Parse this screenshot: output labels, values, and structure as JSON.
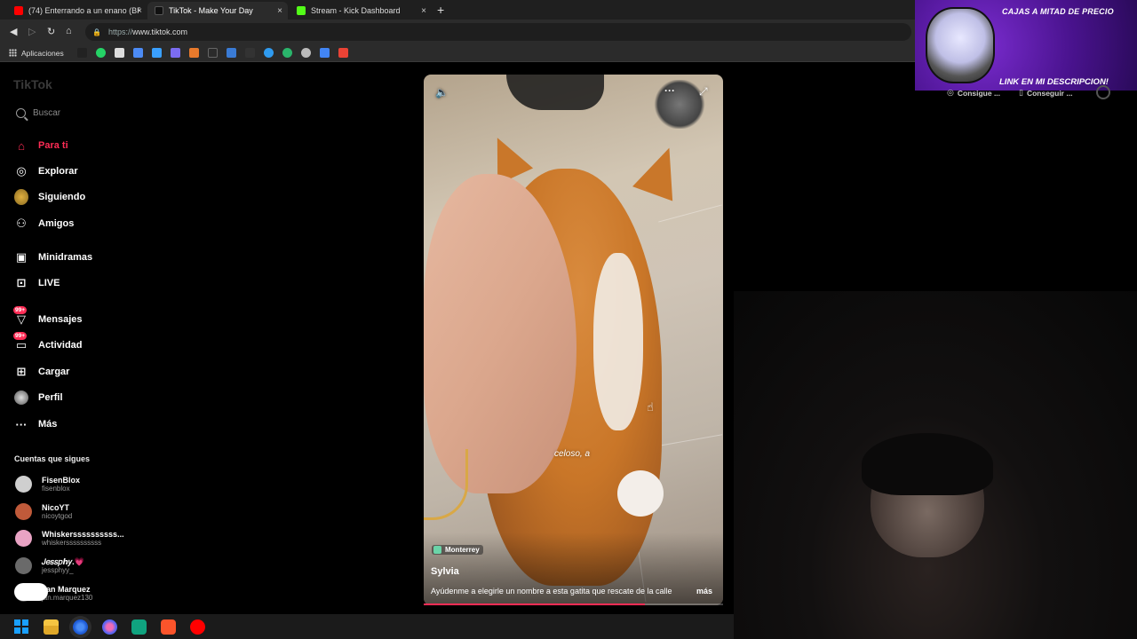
{
  "browser": {
    "tabs": [
      {
        "title": "(74) Enterrando a un enano (BR",
        "favicon_color": "#ff0000",
        "close": "×"
      },
      {
        "title": "TikTok - Make Your Day",
        "favicon_color": "#111111",
        "close": "×"
      },
      {
        "title": "Stream - Kick Dashboard",
        "favicon_color": "#53fc18",
        "close": "×"
      }
    ],
    "new_tab": "+",
    "url_scheme": "https://",
    "url_host": "www.tiktok.com",
    "bookmarks_apps_label": "Aplicaciones"
  },
  "sidebar": {
    "logo": "TikTok",
    "search_placeholder": "Buscar",
    "items": [
      {
        "label": "Para ti",
        "icon": "home-icon",
        "glyph": "⌂"
      },
      {
        "label": "Explorar",
        "icon": "compass-icon",
        "glyph": "◎"
      },
      {
        "label": "Siguiendo",
        "icon": "following-avatar-icon",
        "glyph": ""
      },
      {
        "label": "Amigos",
        "icon": "friends-icon",
        "glyph": "👥"
      },
      {
        "label": "Minidramas",
        "icon": "minidrama-icon",
        "glyph": "▣"
      },
      {
        "label": "LIVE",
        "icon": "live-icon",
        "glyph": "📺"
      },
      {
        "label": "Mensajes",
        "icon": "messages-icon",
        "glyph": "▽",
        "badge": "99+"
      },
      {
        "label": "Actividad",
        "icon": "activity-icon",
        "glyph": "▭",
        "badge": "99+"
      },
      {
        "label": "Cargar",
        "icon": "upload-icon",
        "glyph": "⊞"
      },
      {
        "label": "Perfil",
        "icon": "profile-avatar-icon",
        "glyph": ""
      },
      {
        "label": "Más",
        "icon": "more-dots-icon",
        "glyph": "···"
      }
    ],
    "following_title": "Cuentas que sigues",
    "following": [
      {
        "name": "FisenBlox",
        "username": "fisenblox",
        "avatar_color": "#cfcfcf"
      },
      {
        "name": "NicoYT",
        "username": "nicoytgod",
        "avatar_color": "#c05a3a"
      },
      {
        "name": "Whiskerssssssssss...",
        "username": "whiskerssssssssss",
        "avatar_color": "#e9a3c4"
      },
      {
        "name": "𝐽𝑒𝑠𝑠𝑝ℎ𝑦.💗",
        "username": "jessphyy_",
        "avatar_color": "#6a6a6a"
      },
      {
        "name": "Jan Marquez",
        "username": "jan.marquez130",
        "avatar_color": "#444444"
      }
    ]
  },
  "video": {
    "caption_overlay": "celoso, a",
    "location": "Monterrey",
    "author": "Sylvia",
    "description": "Ayúdenme a elegirle un nombre a esta gatita que rescate de la calle",
    "more_label": "más",
    "progress": 0.74
  },
  "stream_overlay": {
    "promo_top": "CAJAS A MITAD DE PRECIO",
    "promo_bottom": "LINK EN MI DESCRIPCION!",
    "ext_1": "Consigue ...",
    "ext_2": "Conseguir ..."
  },
  "taskbar": {
    "apps": [
      "start-icon",
      "file-explorer-icon",
      "chrome-icon",
      "discord-icon",
      "chatgpt-icon",
      "brave-icon",
      "youtube-icon"
    ]
  }
}
